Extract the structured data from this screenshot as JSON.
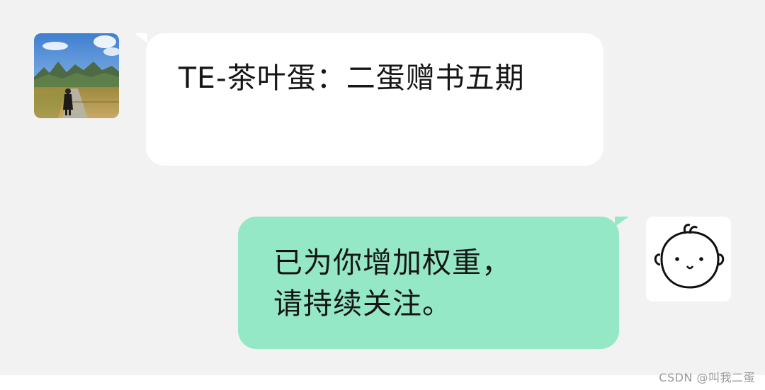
{
  "messages": [
    {
      "direction": "incoming",
      "text": "TE-茶叶蛋：二蛋赠书五期",
      "avatar_icon": "landscape-photo-avatar",
      "bubble_color": "#ffffff"
    },
    {
      "direction": "outgoing",
      "line1": "已为你增加权重，",
      "line2": "请持续关注。",
      "avatar_icon": "cartoon-baby-face-avatar",
      "bubble_color": "#95e8c6"
    }
  ],
  "watermark": "CSDN @叫我二蛋",
  "colors": {
    "background": "#f2f2f2",
    "incoming_bubble": "#ffffff",
    "outgoing_bubble": "#95e8c6"
  }
}
